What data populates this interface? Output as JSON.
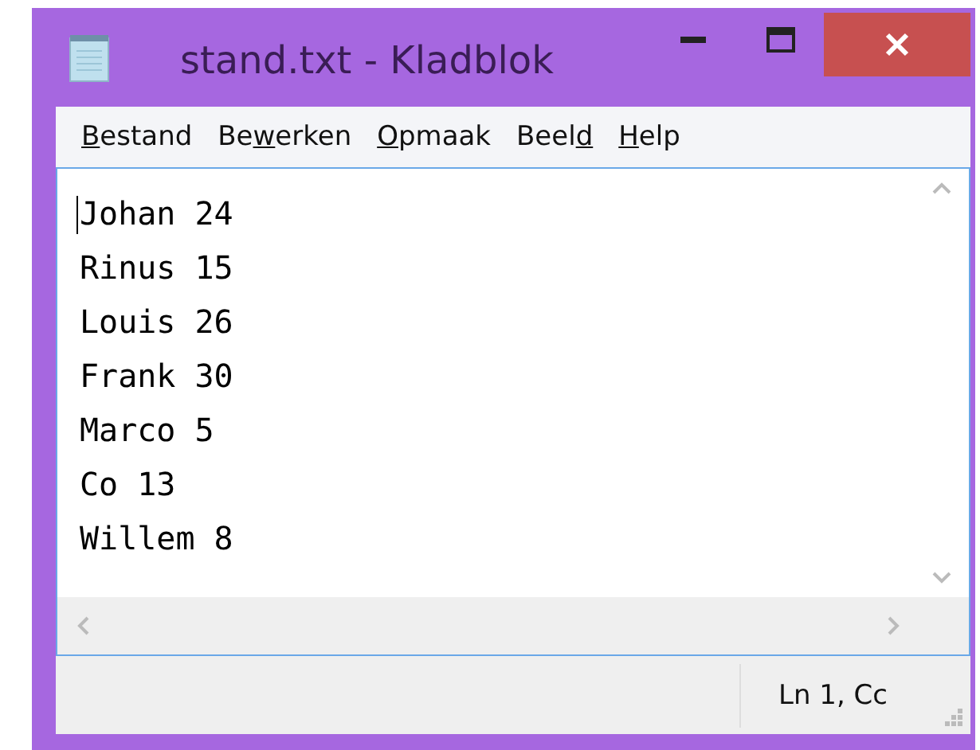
{
  "window": {
    "title": "stand.txt - Kladblok"
  },
  "menu": [
    {
      "key": "B",
      "after": "estand"
    },
    {
      "before": "Be",
      "key": "w",
      "after": "erken"
    },
    {
      "key": "O",
      "after": "pmaak"
    },
    {
      "before": "Beel",
      "key": "d"
    },
    {
      "key": "H",
      "after": "elp"
    }
  ],
  "editor": {
    "lines": [
      "Johan 24",
      "Rinus 15",
      "Louis 26",
      "Frank 30",
      "Marco 5",
      "Co 13",
      "Willem 8"
    ]
  },
  "status_bar": {
    "position": "Ln 1, Cc"
  }
}
